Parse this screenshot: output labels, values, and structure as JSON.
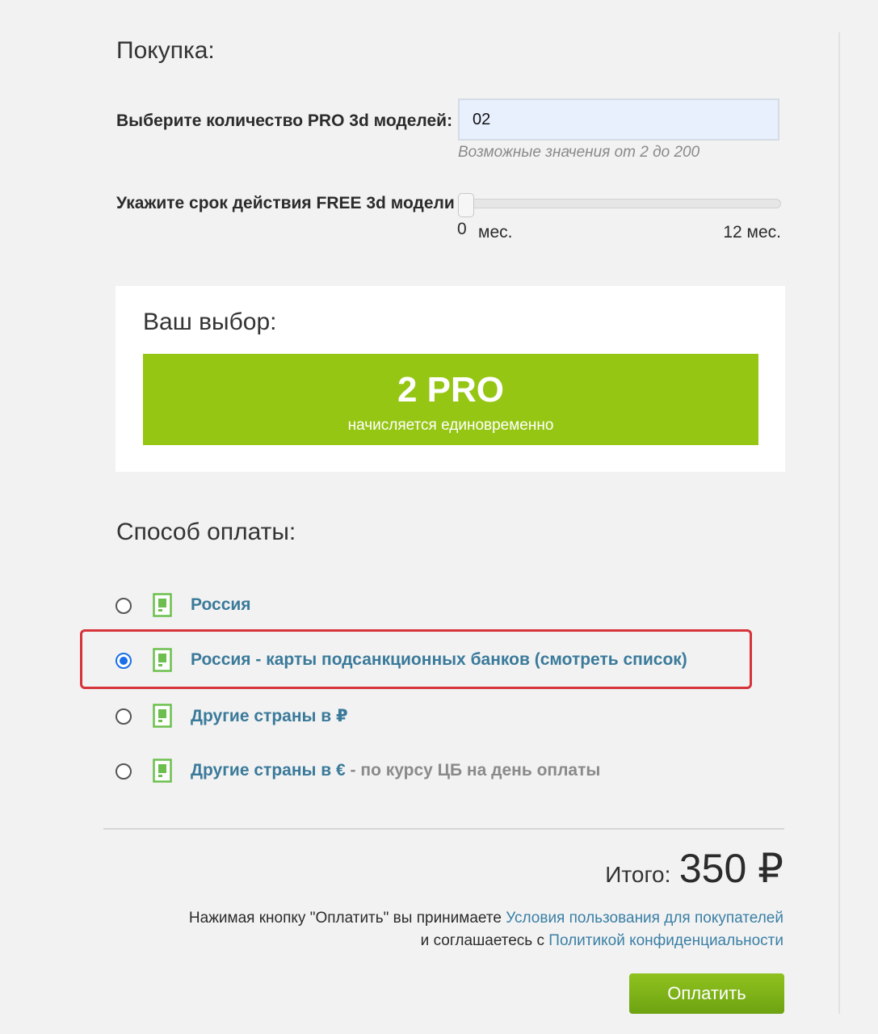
{
  "purchase": {
    "title": "Покупка:",
    "quantity_label": "Выберите количество PRO 3d моделей:",
    "quantity_value": "02",
    "quantity_hint": "Возможные значения от 2 до 200",
    "term_label": "Укажите срок действия FREE 3d модели",
    "slider_value": 0,
    "slider_min_number": "0",
    "slider_min_unit": "мес.",
    "slider_max_label": "12 мес."
  },
  "choice": {
    "title": "Ваш выбор:",
    "banner_main": "2 PRO",
    "banner_sub": "начисляется единовременно",
    "banner_color": "#96c614"
  },
  "payment": {
    "title": "Способ оплаты:",
    "options": [
      {
        "label": "Россия",
        "note": "",
        "selected": false,
        "icon": "document-icon"
      },
      {
        "label": "Россия - карты подсанкционных банков (смотреть список)",
        "note": "",
        "selected": true,
        "icon": "document-icon"
      },
      {
        "label": "Другие страны в ₽",
        "note": "",
        "selected": false,
        "icon": "document-icon"
      },
      {
        "label": "Другие страны в €",
        "note": " - по курсу ЦБ на день оплаты",
        "selected": false,
        "icon": "document-icon"
      }
    ],
    "highlight_color": "#d6333a",
    "link_color": "#3a7a9a"
  },
  "summary": {
    "total_label": "Итого:",
    "total_value": "350 ₽",
    "terms_text_1": "Нажимая кнопку \"Оплатить\" вы принимаете ",
    "terms_link_1": "Условия пользования для покупателей",
    "terms_text_2": "и соглашаетесь с ",
    "terms_link_2": "Политикой конфиденциальности",
    "pay_button": "Оплатить",
    "button_color": "#7bb418"
  }
}
